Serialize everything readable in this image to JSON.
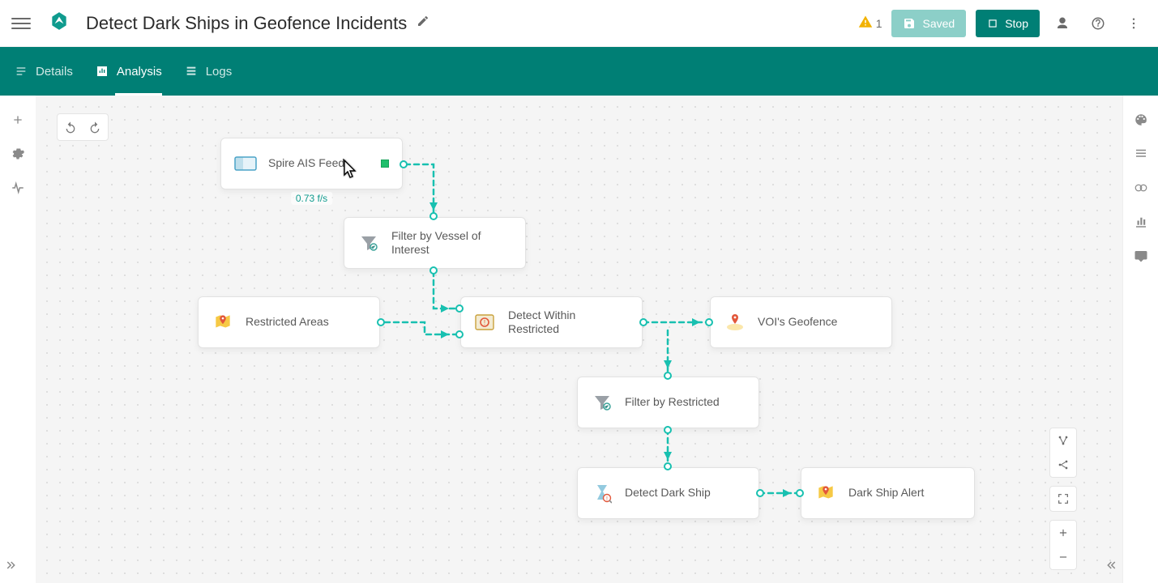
{
  "header": {
    "title": "Detect Dark Ships in Geofence Incidents",
    "warning_count": "1",
    "saved_label": "Saved",
    "stop_label": "Stop"
  },
  "tabs": {
    "details": "Details",
    "analysis": "Analysis",
    "logs": "Logs"
  },
  "canvas": {
    "nodes": {
      "spire": {
        "label": "Spire AIS Feed",
        "rate": "0.73 f/s"
      },
      "filter_voi": {
        "label": "Filter by Vessel of Interest"
      },
      "restricted": {
        "label": "Restricted Areas"
      },
      "detect_within": {
        "label": "Detect Within Restricted"
      },
      "voi_geofence": {
        "label": "VOI's Geofence"
      },
      "filter_restricted": {
        "label": "Filter by Restricted"
      },
      "detect_dark": {
        "label": "Detect Dark Ship"
      },
      "dark_alert": {
        "label": "Dark Ship Alert"
      }
    }
  }
}
